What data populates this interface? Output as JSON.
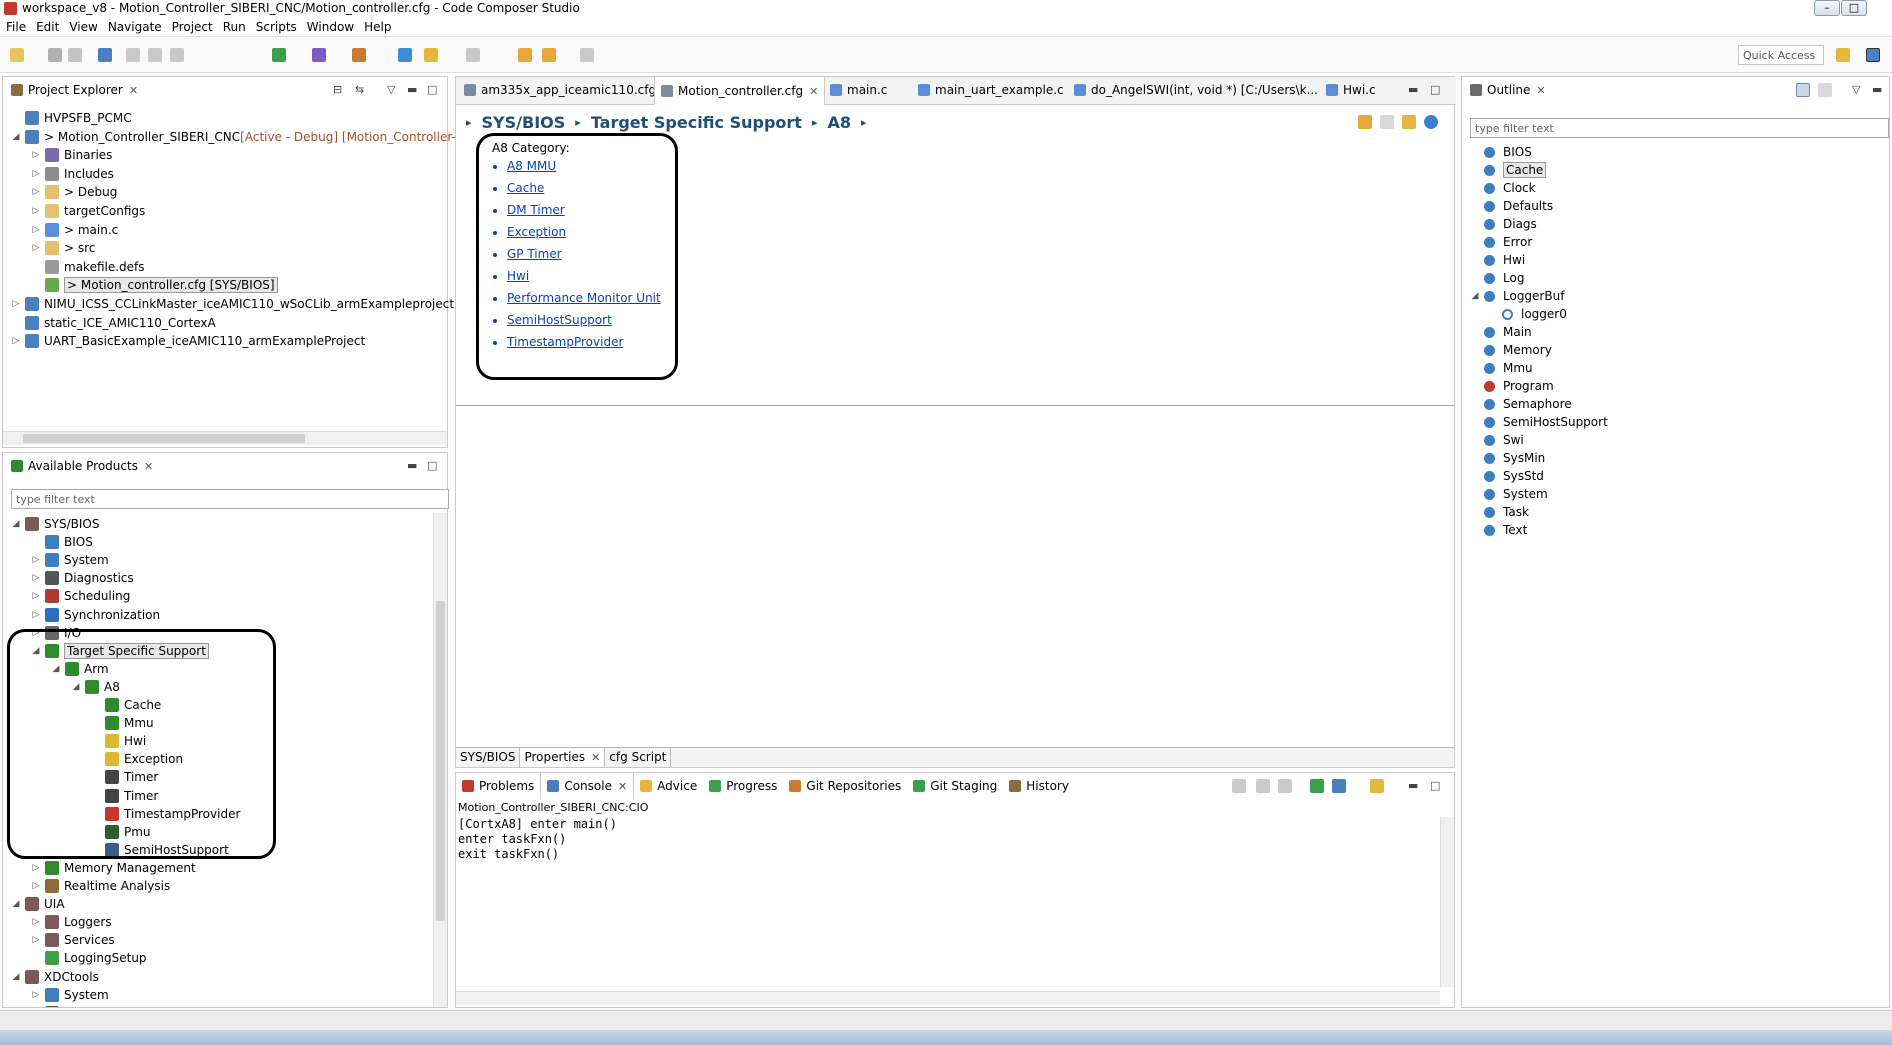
{
  "window": {
    "title": "workspace_v8 - Motion_Controller_SIBERI_CNC/Motion_controller.cfg - Code Composer Studio",
    "controls": [
      "–",
      "□",
      "✕"
    ]
  },
  "menu": [
    "File",
    "Edit",
    "View",
    "Navigate",
    "Project",
    "Run",
    "Scripts",
    "Window",
    "Help"
  ],
  "toolbar": {
    "quick_access": "Quick Access"
  },
  "project_explorer": {
    "tab": "Project Explorer",
    "items": [
      {
        "label": "HVPSFB_PCMC",
        "indent": 0,
        "twisty": "",
        "icon": "project"
      },
      {
        "label": "> Motion_Controller_SIBERI_CNC",
        "suffix": "[Active - Debug] [Motion_Controller-SIBERI",
        "indent": 0,
        "twisty": "◢",
        "icon": "project"
      },
      {
        "label": "Binaries",
        "indent": 1,
        "twisty": "▷",
        "icon": "binaries"
      },
      {
        "label": "Includes",
        "indent": 1,
        "twisty": "▷",
        "icon": "includes"
      },
      {
        "label": "> Debug",
        "indent": 1,
        "twisty": "▷",
        "icon": "folder"
      },
      {
        "label": "targetConfigs",
        "indent": 1,
        "twisty": "▷",
        "icon": "folder"
      },
      {
        "label": "> main.c",
        "indent": 1,
        "twisty": "▷",
        "icon": "cfile"
      },
      {
        "label": "> src",
        "indent": 1,
        "twisty": "▷",
        "icon": "folder"
      },
      {
        "label": "makefile.defs",
        "indent": 1,
        "twisty": "",
        "icon": "file"
      },
      {
        "label": "> Motion_controller.cfg [SYS/BIOS]",
        "indent": 1,
        "twisty": "",
        "icon": "cfg",
        "selected": true
      },
      {
        "label": "NIMU_ICSS_CCLinkMaster_iceAMIC110_wSoCLib_armExampleproject",
        "indent": 0,
        "twisty": "▷",
        "icon": "project"
      },
      {
        "label": "static_ICE_AMIC110_CortexA",
        "indent": 0,
        "twisty": "",
        "icon": "project"
      },
      {
        "label": "UART_BasicExample_iceAMIC110_armExampleProject",
        "indent": 0,
        "twisty": "▷",
        "icon": "project"
      }
    ]
  },
  "available_products": {
    "tab": "Available Products",
    "filter_placeholder": "type filter text",
    "items": [
      {
        "label": "SYS/BIOS",
        "indent": 0,
        "twisty": "◢",
        "icon": "grid"
      },
      {
        "label": "BIOS",
        "indent": 1,
        "twisty": "",
        "icon": "globe"
      },
      {
        "label": "System",
        "indent": 1,
        "twisty": "▷",
        "icon": "globe"
      },
      {
        "label": "Diagnostics",
        "indent": 1,
        "twisty": "▷",
        "icon": "diag"
      },
      {
        "label": "Scheduling",
        "indent": 1,
        "twisty": "▷",
        "icon": "sched"
      },
      {
        "label": "Synchronization",
        "indent": 1,
        "twisty": "▷",
        "icon": "sync"
      },
      {
        "label": "I/O",
        "indent": 1,
        "twisty": "▷",
        "icon": "io"
      },
      {
        "label": "Target Specific Support",
        "indent": 1,
        "twisty": "◢",
        "icon": "chip",
        "selected": true
      },
      {
        "label": "Arm",
        "indent": 2,
        "twisty": "◢",
        "icon": "chip"
      },
      {
        "label": "A8",
        "indent": 3,
        "twisty": "◢",
        "icon": "chip"
      },
      {
        "label": "Cache",
        "indent": 4,
        "twisty": "",
        "icon": "chip"
      },
      {
        "label": "Mmu",
        "indent": 4,
        "twisty": "",
        "icon": "chip"
      },
      {
        "label": "Hwi",
        "indent": 4,
        "twisty": "",
        "icon": "hand"
      },
      {
        "label": "Exception",
        "indent": 4,
        "twisty": "",
        "icon": "hand"
      },
      {
        "label": "Timer",
        "indent": 4,
        "twisty": "",
        "icon": "clock"
      },
      {
        "label": "Timer",
        "indent": 4,
        "twisty": "",
        "icon": "clock"
      },
      {
        "label": "TimestampProvider",
        "indent": 4,
        "twisty": "",
        "icon": "clockred"
      },
      {
        "label": "Pmu",
        "indent": 4,
        "twisty": "",
        "icon": "monitor"
      },
      {
        "label": "SemiHostSupport",
        "indent": 4,
        "twisty": "",
        "icon": "screen"
      },
      {
        "label": "Memory Management",
        "indent": 1,
        "twisty": "▷",
        "icon": "chip"
      },
      {
        "label": "Realtime Analysis",
        "indent": 1,
        "twisty": "▷",
        "icon": "rta"
      },
      {
        "label": "UIA",
        "indent": 0,
        "twisty": "◢",
        "icon": "grid"
      },
      {
        "label": "Loggers",
        "indent": 1,
        "twisty": "▷",
        "icon": "grid"
      },
      {
        "label": "Services",
        "indent": 1,
        "twisty": "▷",
        "icon": "grid"
      },
      {
        "label": "LoggingSetup",
        "indent": 1,
        "twisty": "",
        "icon": "greenball"
      },
      {
        "label": "XDCtools",
        "indent": 0,
        "twisty": "◢",
        "icon": "grid"
      },
      {
        "label": "System",
        "indent": 1,
        "twisty": "▷",
        "icon": "globe"
      },
      {
        "label": "Diagnostics",
        "indent": 1,
        "twisty": "▷",
        "icon": "diag"
      }
    ]
  },
  "editor": {
    "tabs": [
      {
        "label": "am335x_app_iceamic110.cfg",
        "active": false
      },
      {
        "label": "Motion_controller.cfg",
        "active": true,
        "closable": true
      },
      {
        "label": "main.c",
        "active": false
      },
      {
        "label": "main_uart_example.c",
        "active": false
      },
      {
        "label": "do_AngelSWI(int, void *) [C:/Users\\k...",
        "active": false
      },
      {
        "label": "Hwi.c",
        "active": false
      }
    ],
    "breadcrumb": [
      "SYS/BIOS",
      "Target Specific Support",
      "A8"
    ],
    "category_title": "A8 Category:",
    "links": [
      "A8 MMU",
      "Cache",
      "DM Timer",
      "Exception",
      "GP Timer",
      "Hwi",
      "Performance Monitor Unit",
      "SemiHostSupport",
      "TimestampProvider"
    ],
    "bottom_tabs": [
      "SYS/BIOS",
      "Properties",
      "cfg Script"
    ]
  },
  "console": {
    "tabs": [
      "Problems",
      "Console",
      "Advice",
      "Progress",
      "Git Repositories",
      "Git Staging",
      "History"
    ],
    "active_tab": "Console",
    "header": "Motion_Controller_SIBERI_CNC:CIO",
    "lines": [
      "[CortxA8] enter main()",
      "enter taskFxn()",
      "exit taskFxn()"
    ]
  },
  "outline": {
    "tab": "Outline",
    "filter_placeholder": "type filter text",
    "items": [
      {
        "label": "BIOS",
        "indent": 0
      },
      {
        "label": "Cache",
        "indent": 0,
        "selected": true
      },
      {
        "label": "Clock",
        "indent": 0
      },
      {
        "label": "Defaults",
        "indent": 0
      },
      {
        "label": "Diags",
        "indent": 0
      },
      {
        "label": "Error",
        "indent": 0
      },
      {
        "label": "Hwi",
        "indent": 0
      },
      {
        "label": "Log",
        "indent": 0
      },
      {
        "label": "LoggerBuf",
        "indent": 0,
        "twisty": "◢"
      },
      {
        "label": "logger0",
        "indent": 1,
        "hollow": true
      },
      {
        "label": "Main",
        "indent": 0
      },
      {
        "label": "Memory",
        "indent": 0
      },
      {
        "label": "Mmu",
        "indent": 0
      },
      {
        "label": "Program",
        "indent": 0,
        "red": true
      },
      {
        "label": "Semaphore",
        "indent": 0
      },
      {
        "label": "SemiHostSupport",
        "indent": 0
      },
      {
        "label": "Swi",
        "indent": 0
      },
      {
        "label": "SysMin",
        "indent": 0
      },
      {
        "label": "SysStd",
        "indent": 0
      },
      {
        "label": "System",
        "indent": 0
      },
      {
        "label": "Task",
        "indent": 0
      },
      {
        "label": "Text",
        "indent": 0
      }
    ]
  },
  "colors": {
    "breadcrumb": "#1f4e79",
    "link": "#0645ad",
    "outline_dot": "#3d7ebf",
    "outline_dot_red": "#c0392b",
    "chip_green": "#2e8b2e"
  }
}
